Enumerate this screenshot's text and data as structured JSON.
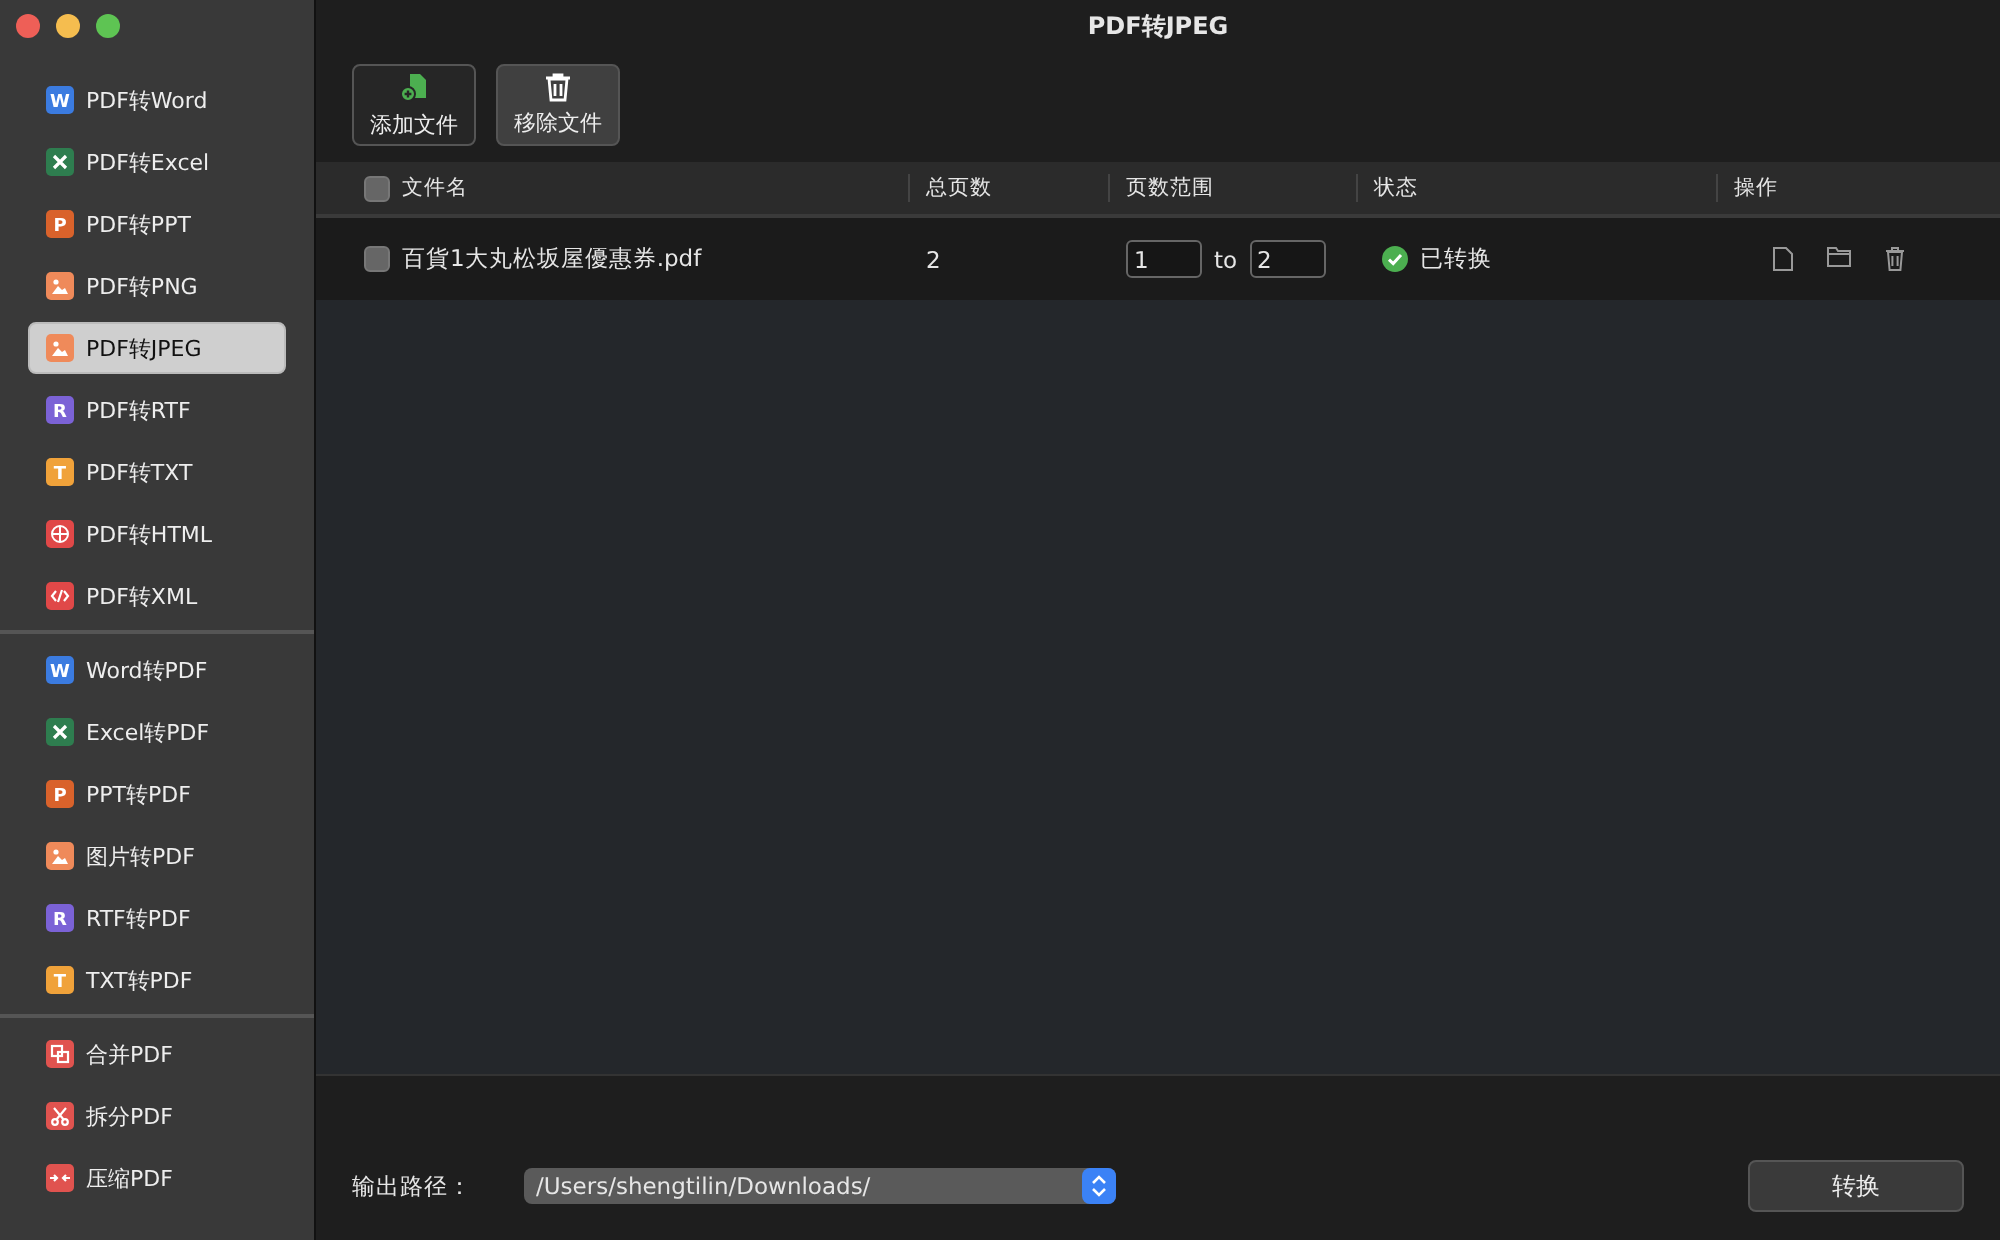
{
  "window": {
    "title": "PDF转JPEG"
  },
  "sidebar": {
    "groups": [
      [
        {
          "label": "PDF转Word",
          "kind": "letter",
          "glyph": "W",
          "color": "#3b7be0",
          "selected": false
        },
        {
          "label": "PDF转Excel",
          "kind": "excel",
          "color": "#2e7d4f",
          "selected": false
        },
        {
          "label": "PDF转PPT",
          "kind": "letter",
          "glyph": "P",
          "color": "#d9622b",
          "selected": false
        },
        {
          "label": "PDF转PNG",
          "kind": "image",
          "color": "#ef8a5a",
          "selected": false
        },
        {
          "label": "PDF转JPEG",
          "kind": "image",
          "color": "#ef8a5a",
          "selected": true
        },
        {
          "label": "PDF转RTF",
          "kind": "letter",
          "glyph": "R",
          "color": "#7b62d6",
          "selected": false
        },
        {
          "label": "PDF转TXT",
          "kind": "letter",
          "glyph": "T",
          "color": "#f0a23a",
          "selected": false
        },
        {
          "label": "PDF转HTML",
          "kind": "globe",
          "color": "#e04848",
          "selected": false
        },
        {
          "label": "PDF转XML",
          "kind": "code",
          "color": "#e04848",
          "selected": false
        }
      ],
      [
        {
          "label": "Word转PDF",
          "kind": "letter",
          "glyph": "W",
          "color": "#3b7be0",
          "selected": false
        },
        {
          "label": "Excel转PDF",
          "kind": "excel",
          "color": "#2e7d4f",
          "selected": false
        },
        {
          "label": "PPT转PDF",
          "kind": "letter",
          "glyph": "P",
          "color": "#d9622b",
          "selected": false
        },
        {
          "label": "图片转PDF",
          "kind": "image",
          "color": "#ef8a5a",
          "selected": false
        },
        {
          "label": "RTF转PDF",
          "kind": "letter",
          "glyph": "R",
          "color": "#7b62d6",
          "selected": false
        },
        {
          "label": "TXT转PDF",
          "kind": "letter",
          "glyph": "T",
          "color": "#f0a23a",
          "selected": false
        }
      ],
      [
        {
          "label": "合并PDF",
          "kind": "merge",
          "color": "#e0534f",
          "selected": false
        },
        {
          "label": "拆分PDF",
          "kind": "split",
          "color": "#e0534f",
          "selected": false
        },
        {
          "label": "压缩PDF",
          "kind": "compress",
          "color": "#e0534f",
          "selected": false
        }
      ]
    ]
  },
  "toolbar": [
    {
      "label": "添加文件",
      "kind": "add"
    },
    {
      "label": "移除文件",
      "kind": "remove"
    }
  ],
  "table": {
    "columns": [
      "文件名",
      "总页数",
      "页数范围",
      "状态",
      "操作"
    ],
    "header_checked": false,
    "rows": [
      {
        "checked": false,
        "name": "百貨1大丸松坂屋優惠券.pdf",
        "pages": "2",
        "from": "1",
        "to_label": "to",
        "to": "2",
        "status": "已转换",
        "done": true
      }
    ]
  },
  "footer": {
    "label": "输出路径：",
    "path": "/Users/shengtilin/Downloads/",
    "button": "转换"
  }
}
